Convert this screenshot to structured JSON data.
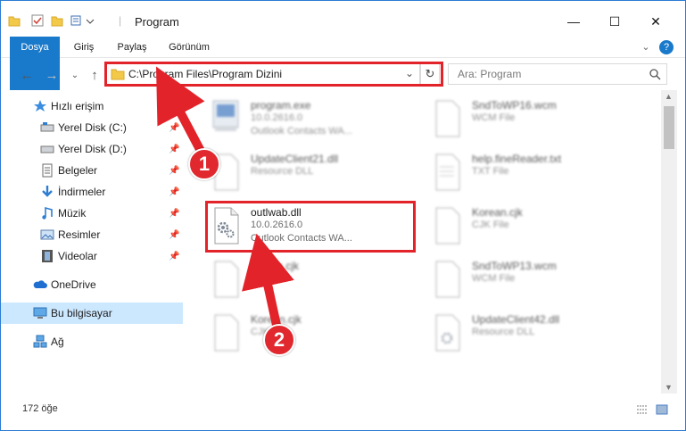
{
  "window": {
    "title": "Program",
    "minimize": "—",
    "maximize": "☐",
    "close": "✕"
  },
  "ribbon": {
    "tabs": [
      "Dosya",
      "Giriş",
      "Paylaş",
      "Görünüm"
    ],
    "help": "?"
  },
  "address_bar": {
    "path": "C:\\Program Files\\Program Dizini"
  },
  "search": {
    "placeholder": "Ara: Program"
  },
  "nav_pane": {
    "quick_access": "Hızlı erişim",
    "pinned": [
      "Yerel Disk (C:)",
      "Yerel Disk (D:)",
      "Belgeler",
      "İndirmeler",
      "Müzik",
      "Resimler",
      "Videolar"
    ],
    "onedrive": "OneDrive",
    "this_pc": "Bu bilgisayar",
    "network": "Ağ"
  },
  "files": {
    "left": [
      {
        "name": "program.exe",
        "version": "10.0.2616.0",
        "type": "Outlook Contacts WA..."
      },
      {
        "name": "UpdateClient21.dll",
        "type": "Resource DLL"
      },
      {
        "name": "outlwab.dll",
        "version": "10.0.2616.0",
        "type": "Outlook Contacts WA..."
      },
      {
        "name": "Ellcom.cjk",
        "type": "CJK File"
      },
      {
        "name": "Korean.cjk",
        "type": "CJK File"
      }
    ],
    "right": [
      {
        "name": "SndToWP16.wcm",
        "type": "WCM File"
      },
      {
        "name": "help.fineReader.txt",
        "type": "TXT File"
      },
      {
        "name": "Korean.cjk",
        "type": "CJK File"
      },
      {
        "name": "SndToWP13.wcm",
        "type": "WCM File"
      },
      {
        "name": "UpdateClient42.dll",
        "type": "Resource DLL"
      }
    ]
  },
  "status": {
    "item_count": "172 öğe"
  },
  "annotations": {
    "step1": "1",
    "step2": "2",
    "color": "#e2232a"
  }
}
